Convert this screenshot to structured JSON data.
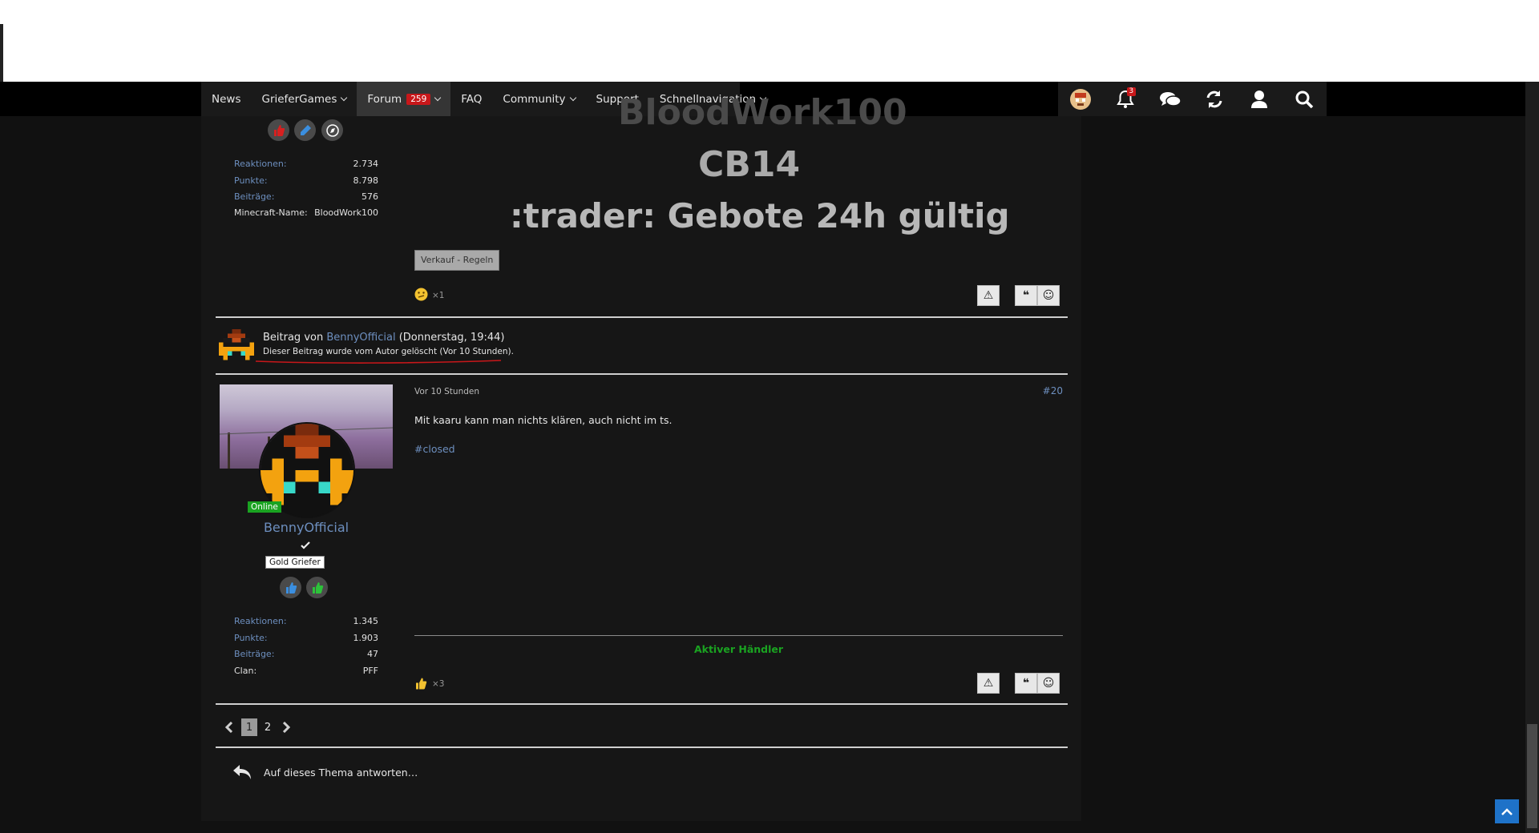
{
  "nav": {
    "items": [
      {
        "label": "News",
        "dropdown": false
      },
      {
        "label": "GrieferGames",
        "dropdown": true
      },
      {
        "label": "Forum",
        "badge": "259",
        "dropdown": true,
        "active": true
      },
      {
        "label": "FAQ",
        "dropdown": false
      },
      {
        "label": "Community",
        "dropdown": true
      },
      {
        "label": "Support",
        "dropdown": false
      },
      {
        "label": "Schnellnavigation",
        "dropdown": true
      }
    ],
    "icons": [
      "avatar-icon",
      "bell-icon",
      "chat-icon",
      "refresh-icon",
      "user-icon",
      "search-icon"
    ],
    "notification_count": "3"
  },
  "post1": {
    "stats": [
      {
        "label": "Reaktionen:",
        "value": "2.734"
      },
      {
        "label": "Punkte:",
        "value": "8.798"
      },
      {
        "label": "Beiträge:",
        "value": "576"
      },
      {
        "label": "Minecraft-Name:",
        "value": "BloodWork100"
      }
    ],
    "big_lines": [
      "BloodWork100",
      "CB14",
      ":trader: Gebote 24h gültig"
    ],
    "tag_label": "Verkauf - Regeln",
    "reaction_count": "×1"
  },
  "deleted": {
    "prefix": "Beitrag von ",
    "author": "BennyOfficial",
    "date": " (Donnerstag, 19:44)",
    "notice": "Dieser Beitrag wurde vom Autor gelöscht (Vor 10 Stunden)."
  },
  "post2": {
    "online_label": "Online",
    "username": "BennyOfficial",
    "rank": "Gold Griefer",
    "time": "Vor 10 Stunden",
    "number": "#20",
    "message": "Mit kaaru kann man nichts klären, auch nicht im ts.",
    "hashtag": "#closed",
    "signature": "Aktiver Händler",
    "reaction_count": "×3",
    "stats": [
      {
        "label": "Reaktionen:",
        "value": "1.345"
      },
      {
        "label": "Punkte:",
        "value": "1.903"
      },
      {
        "label": "Beiträge:",
        "value": "47"
      },
      {
        "label": "Clan:",
        "value": "PFF"
      }
    ]
  },
  "pagination": {
    "pages": [
      "1",
      "2"
    ],
    "current": "1"
  },
  "reply_label": "Auf dieses Thema antworten…",
  "colors": {
    "link": "#6d8fbf",
    "online": "#1aa321",
    "signature": "#1aa321",
    "accent_red": "#c8171a",
    "deleted_underline": "#c8171a"
  }
}
